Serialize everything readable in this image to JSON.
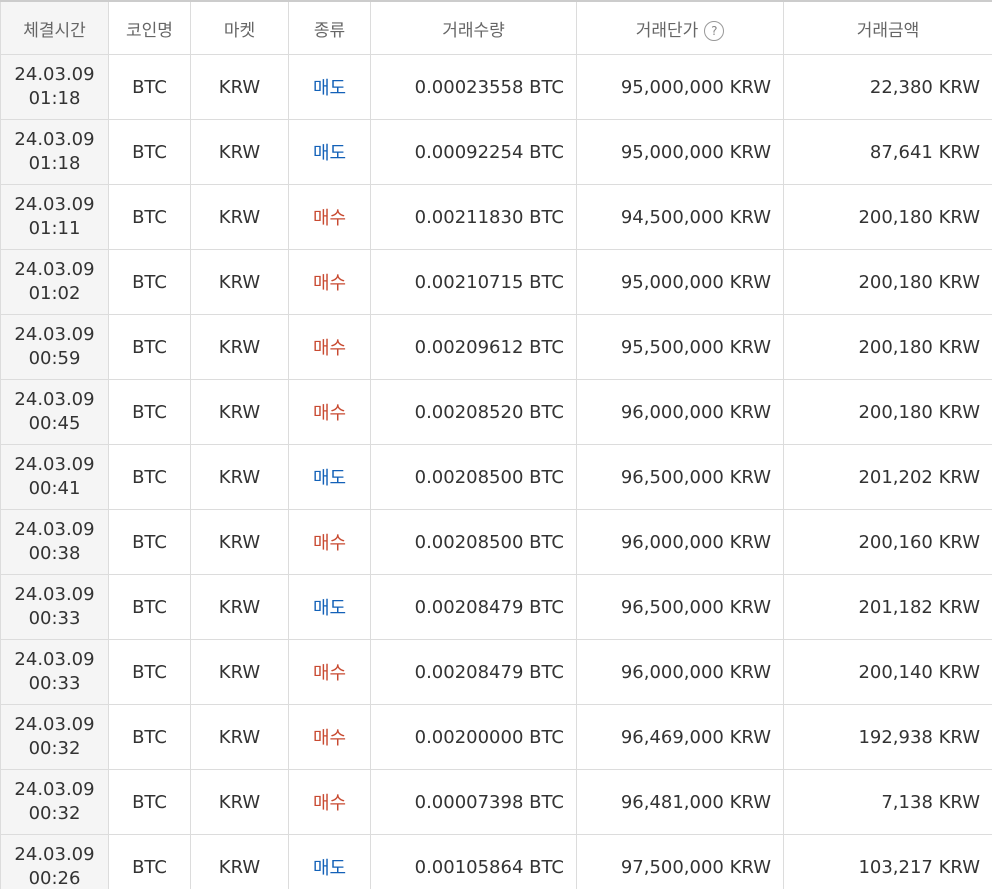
{
  "columns": {
    "time": "체결시간",
    "coin": "코인명",
    "market": "마켓",
    "type": "종류",
    "qty": "거래수량",
    "price": "거래단가",
    "amount": "거래금액"
  },
  "help_icon": "?",
  "colors": {
    "sell": "#1361b8",
    "buy": "#c84a31"
  },
  "rows": [
    {
      "date": "24.03.09",
      "time": "01:18",
      "coin": "BTC",
      "market": "KRW",
      "type": "매도",
      "side": "sell",
      "qty": "0.00023558 BTC",
      "price": "95,000,000 KRW",
      "amount": "22,380 KRW"
    },
    {
      "date": "24.03.09",
      "time": "01:18",
      "coin": "BTC",
      "market": "KRW",
      "type": "매도",
      "side": "sell",
      "qty": "0.00092254 BTC",
      "price": "95,000,000 KRW",
      "amount": "87,641 KRW"
    },
    {
      "date": "24.03.09",
      "time": "01:11",
      "coin": "BTC",
      "market": "KRW",
      "type": "매수",
      "side": "buy",
      "qty": "0.00211830 BTC",
      "price": "94,500,000 KRW",
      "amount": "200,180 KRW"
    },
    {
      "date": "24.03.09",
      "time": "01:02",
      "coin": "BTC",
      "market": "KRW",
      "type": "매수",
      "side": "buy",
      "qty": "0.00210715 BTC",
      "price": "95,000,000 KRW",
      "amount": "200,180 KRW"
    },
    {
      "date": "24.03.09",
      "time": "00:59",
      "coin": "BTC",
      "market": "KRW",
      "type": "매수",
      "side": "buy",
      "qty": "0.00209612 BTC",
      "price": "95,500,000 KRW",
      "amount": "200,180 KRW"
    },
    {
      "date": "24.03.09",
      "time": "00:45",
      "coin": "BTC",
      "market": "KRW",
      "type": "매수",
      "side": "buy",
      "qty": "0.00208520 BTC",
      "price": "96,000,000 KRW",
      "amount": "200,180 KRW"
    },
    {
      "date": "24.03.09",
      "time": "00:41",
      "coin": "BTC",
      "market": "KRW",
      "type": "매도",
      "side": "sell",
      "qty": "0.00208500 BTC",
      "price": "96,500,000 KRW",
      "amount": "201,202 KRW"
    },
    {
      "date": "24.03.09",
      "time": "00:38",
      "coin": "BTC",
      "market": "KRW",
      "type": "매수",
      "side": "buy",
      "qty": "0.00208500 BTC",
      "price": "96,000,000 KRW",
      "amount": "200,160 KRW"
    },
    {
      "date": "24.03.09",
      "time": "00:33",
      "coin": "BTC",
      "market": "KRW",
      "type": "매도",
      "side": "sell",
      "qty": "0.00208479 BTC",
      "price": "96,500,000 KRW",
      "amount": "201,182 KRW"
    },
    {
      "date": "24.03.09",
      "time": "00:33",
      "coin": "BTC",
      "market": "KRW",
      "type": "매수",
      "side": "buy",
      "qty": "0.00208479 BTC",
      "price": "96,000,000 KRW",
      "amount": "200,140 KRW"
    },
    {
      "date": "24.03.09",
      "time": "00:32",
      "coin": "BTC",
      "market": "KRW",
      "type": "매수",
      "side": "buy",
      "qty": "0.00200000 BTC",
      "price": "96,469,000 KRW",
      "amount": "192,938 KRW"
    },
    {
      "date": "24.03.09",
      "time": "00:32",
      "coin": "BTC",
      "market": "KRW",
      "type": "매수",
      "side": "buy",
      "qty": "0.00007398 BTC",
      "price": "96,481,000 KRW",
      "amount": "7,138 KRW"
    },
    {
      "date": "24.03.09",
      "time": "00:26",
      "coin": "BTC",
      "market": "KRW",
      "type": "매도",
      "side": "sell",
      "qty": "0.00105864 BTC",
      "price": "97,500,000 KRW",
      "amount": "103,217 KRW"
    }
  ]
}
